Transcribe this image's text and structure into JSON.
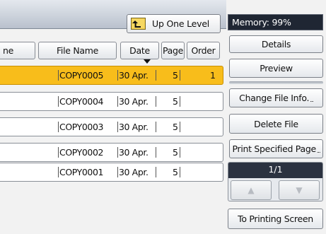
{
  "toolbar": {
    "up_one_level_label": "Up One Level"
  },
  "table": {
    "headers": {
      "name": "ne",
      "file_name": "File Name",
      "date": "Date",
      "page": "Page",
      "order": "Order"
    },
    "rows": [
      {
        "file_name": "COPY0005",
        "date": "30 Apr.",
        "page": "5",
        "order": "1",
        "selected": true
      },
      {
        "file_name": "COPY0004",
        "date": "30 Apr.",
        "page": "5",
        "order": ""
      },
      {
        "file_name": "COPY0003",
        "date": "30 Apr.",
        "page": "5",
        "order": ""
      },
      {
        "file_name": "COPY0002",
        "date": "30 Apr.",
        "page": "5",
        "order": ""
      },
      {
        "file_name": "COPY0001",
        "date": "30 Apr.",
        "page": "5",
        "order": ""
      }
    ]
  },
  "sidebar": {
    "memory": "Memory:  99%",
    "details": "Details",
    "preview": "Preview",
    "change_file_info": "Change File Info.",
    "delete_file": "Delete File",
    "print_specified_page": "Print Specified Page",
    "pager_label": "1/1",
    "to_printing_screen": "To Printing Screen"
  },
  "colors": {
    "selected_row": "#f8bd1b",
    "memory_bg": "#1f2633"
  },
  "icons": {
    "up_level": "folder-up-icon",
    "page_up": "triangle-up-icon",
    "page_down": "triangle-down-icon"
  }
}
